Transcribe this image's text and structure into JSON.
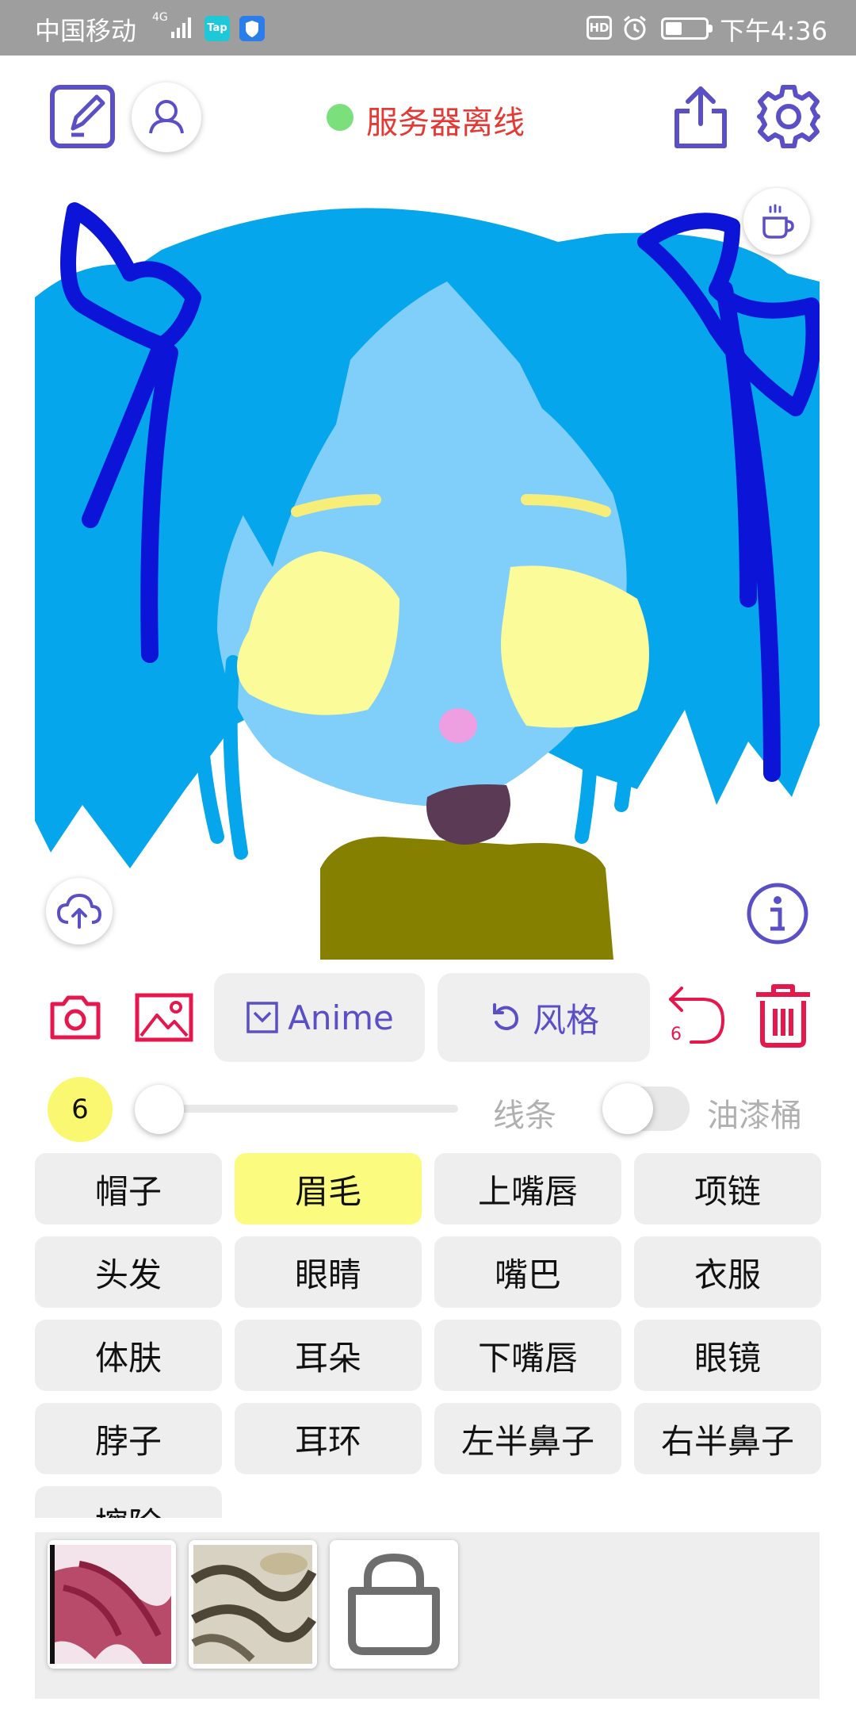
{
  "status_bar": {
    "carrier": "中国移动",
    "network": "4G",
    "app_badge": "Tap",
    "hd_label": "HD",
    "time": "下午4:36"
  },
  "header": {
    "server_status": "服务器离线",
    "server_status_color": "#e53935",
    "server_dot_color": "#7be07b"
  },
  "actions": {
    "anime_label": "Anime",
    "style_label": "风格",
    "undo_count": "6"
  },
  "brush": {
    "size": "6",
    "size_level": 0.0,
    "lines_label": "线条",
    "bucket_label": "油漆桶",
    "bucket_enabled": false
  },
  "categories": [
    {
      "label": "帽子",
      "selected": false
    },
    {
      "label": "眉毛",
      "selected": true
    },
    {
      "label": "上嘴唇",
      "selected": false
    },
    {
      "label": "项链",
      "selected": false
    },
    {
      "label": "头发",
      "selected": false
    },
    {
      "label": "眼睛",
      "selected": false
    },
    {
      "label": "嘴巴",
      "selected": false
    },
    {
      "label": "衣服",
      "selected": false
    },
    {
      "label": "体肤",
      "selected": false
    },
    {
      "label": "耳朵",
      "selected": false
    },
    {
      "label": "下嘴唇",
      "selected": false
    },
    {
      "label": "眼镜",
      "selected": false
    },
    {
      "label": "脖子",
      "selected": false
    },
    {
      "label": "耳环",
      "selected": false
    },
    {
      "label": "左半鼻子",
      "selected": false
    },
    {
      "label": "右半鼻子",
      "selected": false
    },
    {
      "label": "擦除",
      "selected": false
    }
  ],
  "icons": {
    "edit": "edit-icon",
    "profile": "user-icon",
    "share": "share-icon",
    "settings": "gear-icon",
    "coffee": "coffee-icon",
    "upload": "cloud-upload-icon",
    "info": "info-icon",
    "camera": "camera-icon",
    "gallery": "image-icon",
    "undo": "undo-icon",
    "delete": "trash-icon",
    "store": "shopping-bag-icon"
  },
  "colors": {
    "accent": "#5b4fc7",
    "danger": "#e5174d",
    "highlight": "#fbfb7f"
  }
}
